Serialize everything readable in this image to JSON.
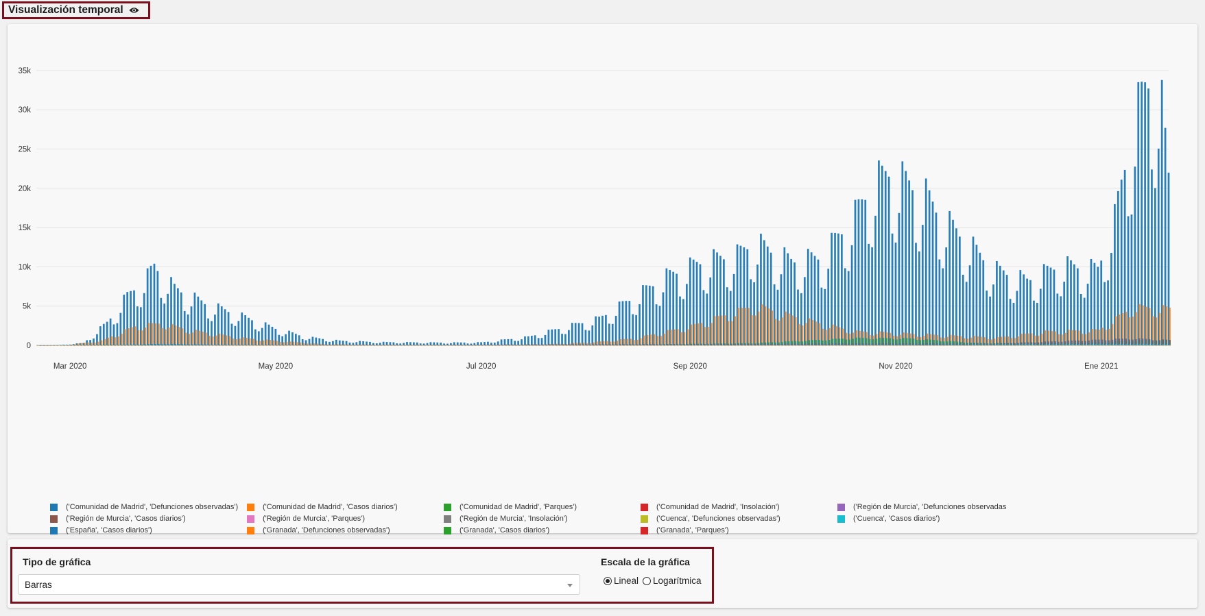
{
  "page": {
    "title": "Visualización temporal",
    "title_icon": "eye-icon"
  },
  "chart_data": {
    "type": "bar",
    "title": "",
    "xlabel": "",
    "ylabel": "",
    "ylim": [
      0,
      37000
    ],
    "yticks": [
      0,
      5000,
      10000,
      15000,
      20000,
      25000,
      30000,
      35000
    ],
    "ytick_labels": [
      "0",
      "5k",
      "10k",
      "15k",
      "20k",
      "25k",
      "30k",
      "35k"
    ],
    "xticks": [
      "2020-03-01",
      "2020-05-01",
      "2020-07-01",
      "2020-09-01",
      "2020-11-01",
      "2021-01-01"
    ],
    "xtick_labels": [
      "Mar 2020",
      "May 2020",
      "Jul 2020",
      "Sep 2020",
      "Nov 2020",
      "Ene 2021"
    ],
    "x_start": "2020-02-20",
    "x_end": "2021-01-21",
    "grid": true,
    "legend_position": "bottom",
    "series": [
      {
        "name": "('Comunidad de Madrid', 'Defunciones observadas')",
        "color": "#1f77b4",
        "keypoints": [
          [
            "2020-02-20",
            5
          ],
          [
            "2020-03-15",
            40
          ],
          [
            "2020-03-27",
            180
          ],
          [
            "2020-04-15",
            80
          ],
          [
            "2020-05-15",
            20
          ],
          [
            "2020-07-01",
            10
          ],
          [
            "2020-09-15",
            20
          ],
          [
            "2020-11-01",
            25
          ],
          [
            "2021-01-21",
            30
          ]
        ]
      },
      {
        "name": "('Comunidad de Madrid', 'Casos diarios')",
        "color": "#ff7f0e",
        "keypoints": [
          [
            "2020-02-20",
            0
          ],
          [
            "2020-02-28",
            10
          ],
          [
            "2020-03-10",
            600
          ],
          [
            "2020-03-20",
            2500
          ],
          [
            "2020-03-28",
            2900
          ],
          [
            "2020-04-05",
            2000
          ],
          [
            "2020-04-20",
            1000
          ],
          [
            "2020-05-01",
            600
          ],
          [
            "2020-05-15",
            150
          ],
          [
            "2020-06-01",
            80
          ],
          [
            "2020-07-01",
            60
          ],
          [
            "2020-07-20",
            150
          ],
          [
            "2020-08-01",
            350
          ],
          [
            "2020-08-15",
            900
          ],
          [
            "2020-09-01",
            2500
          ],
          [
            "2020-09-10",
            3800
          ],
          [
            "2020-09-20",
            5200
          ],
          [
            "2020-10-01",
            3800
          ],
          [
            "2020-10-10",
            2800
          ],
          [
            "2020-10-20",
            1800
          ],
          [
            "2020-11-01",
            1600
          ],
          [
            "2020-11-15",
            1300
          ],
          [
            "2020-12-01",
            1000
          ],
          [
            "2020-12-15",
            1800
          ],
          [
            "2020-12-31",
            2000
          ],
          [
            "2021-01-10",
            5000
          ],
          [
            "2021-01-21",
            4800
          ]
        ]
      },
      {
        "name": "('Comunidad de Madrid', 'Parques')",
        "color": "#2ca02c",
        "keypoints": [
          [
            "2020-02-20",
            0
          ],
          [
            "2021-01-21",
            0
          ]
        ]
      },
      {
        "name": "('Comunidad de Madrid', 'Insolación')",
        "color": "#d62728",
        "keypoints": [
          [
            "2020-02-20",
            0
          ],
          [
            "2020-06-15",
            30
          ],
          [
            "2020-08-01",
            60
          ],
          [
            "2020-09-15",
            30
          ],
          [
            "2020-11-01",
            20
          ],
          [
            "2021-01-21",
            15
          ]
        ]
      },
      {
        "name": "('Región de Murcia', 'Defunciones observadas",
        "color": "#9467bd",
        "keypoints": [
          [
            "2020-02-20",
            3
          ],
          [
            "2020-04-01",
            20
          ],
          [
            "2020-06-01",
            5
          ],
          [
            "2020-10-15",
            15
          ],
          [
            "2021-01-21",
            30
          ]
        ]
      },
      {
        "name": "('Región de Murcia', 'Casos diarios')",
        "color": "#8c564b",
        "keypoints": [
          [
            "2020-02-20",
            0
          ],
          [
            "2020-03-20",
            40
          ],
          [
            "2020-05-01",
            5
          ],
          [
            "2020-08-15",
            150
          ],
          [
            "2020-10-15",
            250
          ],
          [
            "2020-12-01",
            250
          ],
          [
            "2021-01-10",
            900
          ],
          [
            "2021-01-21",
            700
          ]
        ]
      },
      {
        "name": "('Región de Murcia', 'Parques')",
        "color": "#e377c2",
        "keypoints": [
          [
            "2020-02-20",
            0
          ],
          [
            "2021-01-21",
            0
          ]
        ]
      },
      {
        "name": "('Región de Murcia', 'Insolación')",
        "color": "#7f7f7f",
        "keypoints": [
          [
            "2020-02-20",
            0
          ],
          [
            "2020-07-15",
            20
          ],
          [
            "2021-01-21",
            10
          ]
        ]
      },
      {
        "name": "('Cuenca', 'Defunciones observadas')",
        "color": "#bcbd22",
        "keypoints": [
          [
            "2020-02-20",
            2
          ],
          [
            "2021-01-21",
            5
          ]
        ]
      },
      {
        "name": "('Cuenca', 'Casos diarios')",
        "color": "#17becf",
        "keypoints": [
          [
            "2020-02-20",
            0
          ],
          [
            "2020-03-25",
            60
          ],
          [
            "2020-05-01",
            5
          ],
          [
            "2020-10-01",
            40
          ],
          [
            "2021-01-15",
            150
          ],
          [
            "2021-01-21",
            100
          ]
        ]
      },
      {
        "name": "('España', 'Casos diarios')",
        "color": "#1f77b4",
        "keypoints": [
          [
            "2020-02-20",
            0
          ],
          [
            "2020-02-26",
            20
          ],
          [
            "2020-03-05",
            300
          ],
          [
            "2020-03-12",
            3000
          ],
          [
            "2020-03-18",
            6500
          ],
          [
            "2020-03-24",
            9000
          ],
          [
            "2020-03-26",
            10400
          ],
          [
            "2020-04-01",
            7500
          ],
          [
            "2020-04-10",
            5500
          ],
          [
            "2020-04-20",
            4000
          ],
          [
            "2020-05-01",
            2200
          ],
          [
            "2020-05-10",
            1100
          ],
          [
            "2020-05-20",
            600
          ],
          [
            "2020-06-01",
            420
          ],
          [
            "2020-06-20",
            360
          ],
          [
            "2020-07-01",
            380
          ],
          [
            "2020-07-15",
            1100
          ],
          [
            "2020-07-25",
            2300
          ],
          [
            "2020-08-05",
            3500
          ],
          [
            "2020-08-15",
            6200
          ],
          [
            "2020-08-25",
            9000
          ],
          [
            "2020-09-05",
            11000
          ],
          [
            "2020-09-15",
            11800
          ],
          [
            "2020-09-20",
            13500
          ],
          [
            "2020-10-01",
            11000
          ],
          [
            "2020-10-10",
            11500
          ],
          [
            "2020-10-20",
            17000
          ],
          [
            "2020-10-25",
            21000
          ],
          [
            "2020-10-30",
            22500
          ],
          [
            "2020-11-05",
            21000
          ],
          [
            "2020-11-10",
            19500
          ],
          [
            "2020-11-15",
            16500
          ],
          [
            "2020-11-20",
            14500
          ],
          [
            "2020-11-30",
            10000
          ],
          [
            "2020-12-10",
            8500
          ],
          [
            "2020-12-20",
            10500
          ],
          [
            "2020-12-31",
            10000
          ],
          [
            "2021-01-05",
            16500
          ],
          [
            "2021-01-10",
            28000
          ],
          [
            "2021-01-14",
            33500
          ],
          [
            "2021-01-16",
            35000
          ],
          [
            "2021-01-19",
            31000
          ],
          [
            "2021-01-21",
            22000
          ]
        ]
      },
      {
        "name": "('Granada', 'Defunciones observadas')",
        "color": "#ff7f0e",
        "keypoints": [
          [
            "2020-02-20",
            2
          ],
          [
            "2021-01-21",
            8
          ]
        ]
      },
      {
        "name": "('Granada', 'Casos diarios')",
        "color": "#2ca02c",
        "keypoints": [
          [
            "2020-02-20",
            0
          ],
          [
            "2020-03-25",
            100
          ],
          [
            "2020-05-01",
            10
          ],
          [
            "2020-08-15",
            100
          ],
          [
            "2020-09-20",
            300
          ],
          [
            "2020-10-20",
            950
          ],
          [
            "2020-11-05",
            900
          ],
          [
            "2020-11-25",
            300
          ],
          [
            "2020-12-25",
            300
          ],
          [
            "2021-01-15",
            700
          ],
          [
            "2021-01-21",
            650
          ]
        ]
      },
      {
        "name": "('Granada', 'Parques')",
        "color": "#d62728",
        "keypoints": [
          [
            "2020-02-20",
            0
          ],
          [
            "2021-01-21",
            0
          ]
        ]
      }
    ]
  },
  "controls": {
    "chart_type_label": "Tipo de gráfica",
    "chart_type_value": "Barras",
    "scale_label": "Escala de la gráfica",
    "scale_options": [
      "Lineal",
      "Logarítmica"
    ],
    "scale_selected": "Lineal"
  }
}
